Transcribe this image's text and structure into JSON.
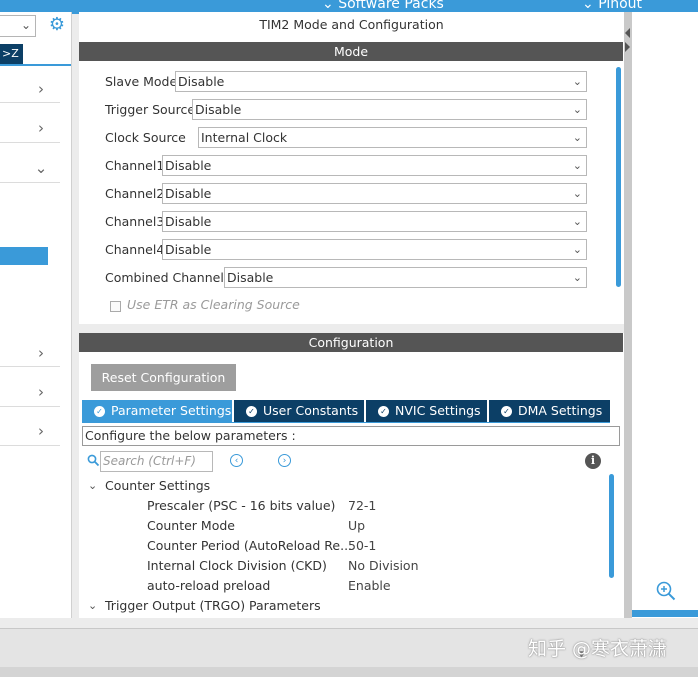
{
  "top_bar": {
    "software_packs": "Software Packs",
    "pinout": "Pinout"
  },
  "left_panel": {
    "category_tag": ">Z"
  },
  "mode_panel": {
    "title": "TIM2 Mode and Configuration",
    "section_label": "Mode",
    "fields": [
      {
        "label": "Slave Mode",
        "value": "Disable"
      },
      {
        "label": "Trigger Source",
        "value": "Disable"
      },
      {
        "label": "Clock Source",
        "value": "Internal Clock"
      },
      {
        "label": "Channel1",
        "value": "Disable"
      },
      {
        "label": "Channel2",
        "value": "Disable"
      },
      {
        "label": "Channel3",
        "value": "Disable"
      },
      {
        "label": "Channel4",
        "value": "Disable"
      },
      {
        "label": "Combined Channels",
        "value": "Disable"
      }
    ],
    "etr_checkbox_label": "Use ETR as Clearing Source",
    "etr_checked": false
  },
  "config_panel": {
    "section_label": "Configuration",
    "reset_button": "Reset Configuration",
    "tabs": [
      {
        "label": "Parameter Settings",
        "active": true
      },
      {
        "label": "User Constants",
        "active": false
      },
      {
        "label": "NVIC Settings",
        "active": false
      },
      {
        "label": "DMA Settings",
        "active": false
      }
    ],
    "description": "Configure the below parameters :",
    "search_placeholder": "Search (Ctrl+F)",
    "groups": [
      {
        "label": "Counter Settings",
        "expanded": true,
        "params": [
          {
            "name": "Prescaler (PSC - 16 bits value)",
            "value": "72-1"
          },
          {
            "name": "Counter Mode",
            "value": "Up"
          },
          {
            "name": "Counter Period (AutoReload Re...",
            "value": "50-1"
          },
          {
            "name": "Internal Clock Division (CKD)",
            "value": "No Division"
          },
          {
            "name": "auto-reload preload",
            "value": "Enable"
          }
        ]
      },
      {
        "label": "Trigger Output (TRGO) Parameters",
        "expanded": true
      }
    ]
  },
  "watermark": "知乎 @寒衣萧潇",
  "colors": {
    "accent": "#3a9ad9",
    "tab_bar": "#0c3f66",
    "header": "#555555",
    "button": "#9e9e9e"
  }
}
